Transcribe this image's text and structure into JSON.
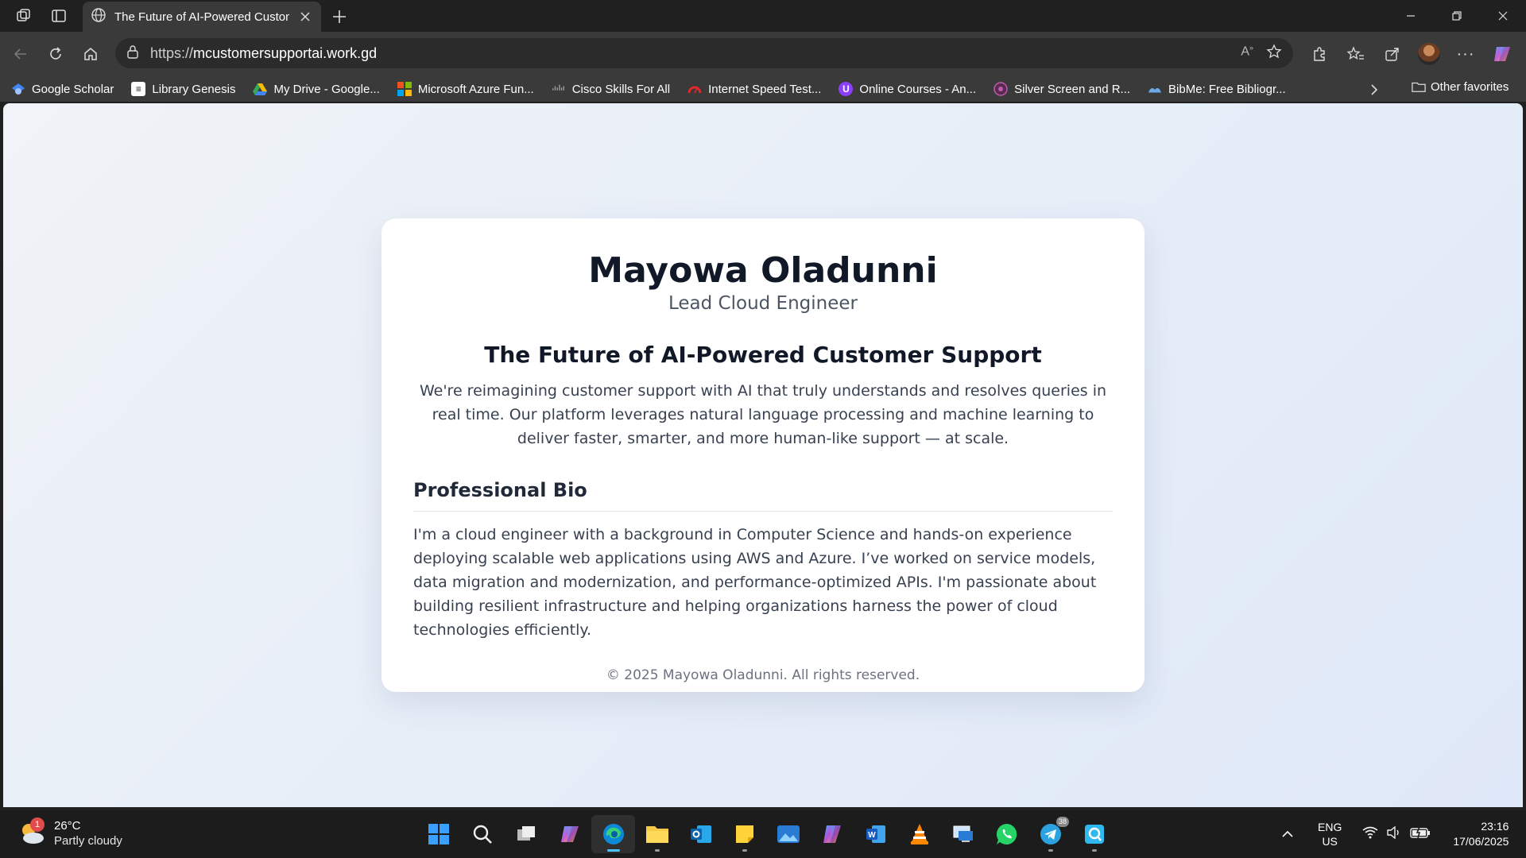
{
  "browser": {
    "tab": {
      "title": "The Future of AI-Powered Custom"
    },
    "address": {
      "scheme": "https://",
      "host": "mcustomersupportai.work.gd"
    },
    "favorites": [
      {
        "label": "Google Scholar",
        "icon": "google-scholar-icon",
        "color": "#4285f4"
      },
      {
        "label": "Library Genesis",
        "icon": "library-genesis-icon",
        "color": "#ffffff"
      },
      {
        "label": "My Drive - Google...",
        "icon": "google-drive-icon",
        "color": "#fbbc04"
      },
      {
        "label": "Microsoft Azure Fun...",
        "icon": "microsoft-icon",
        "color": "#f25022"
      },
      {
        "label": "Cisco Skills For All",
        "icon": "cisco-icon",
        "color": "#9aa0a6"
      },
      {
        "label": "Internet Speed Test...",
        "icon": "speedtest-icon",
        "color": "#e0282e"
      },
      {
        "label": "Online Courses - An...",
        "icon": "courses-icon",
        "color": "#8a3ffc"
      },
      {
        "label": "Silver Screen and R...",
        "icon": "silver-screen-icon",
        "color": "#c05ab0"
      },
      {
        "label": "BibMe: Free Bibliogr...",
        "icon": "bibme-icon",
        "color": "#6aa8e8"
      }
    ],
    "other_favorites": "Other favorites"
  },
  "page": {
    "name": "Mayowa Oladunni",
    "role": "Lead Cloud Engineer",
    "headline": "The Future of AI-Powered Customer Support",
    "intro": "We're reimagining customer support with AI that truly understands and resolves queries in real time. Our platform leverages natural language processing and machine learning to deliver faster, smarter, and more human-like support — at scale.",
    "bio_title": "Professional Bio",
    "bio": "I'm a cloud engineer with a background in Computer Science and hands-on experience deploying scalable web applications using AWS and Azure. I’ve worked on service models, data migration and modernization, and performance-optimized APIs. I'm passionate about building resilient infrastructure and helping organizations harness the power of cloud technologies efficiently.",
    "footer": "© 2025 Mayowa Oladunni. All rights reserved."
  },
  "taskbar": {
    "weather": {
      "temp": "26°C",
      "desc": "Partly cloudy",
      "badge": "1"
    },
    "apps": [
      "start-icon",
      "search-icon",
      "task-view-icon",
      "copilot-icon",
      "edge-icon",
      "file-explorer-icon",
      "outlook-icon",
      "sticky-notes-icon",
      "photos-icon",
      "m365-icon",
      "word-icon",
      "vlc-icon",
      "remote-desktop-icon",
      "whatsapp-icon",
      "telegram-icon",
      "quick-assist-icon"
    ],
    "telegram_badge": "38",
    "lang": {
      "line1": "ENG",
      "line2": "US"
    },
    "clock": {
      "time": "23:16",
      "date": "17/06/2025"
    }
  }
}
